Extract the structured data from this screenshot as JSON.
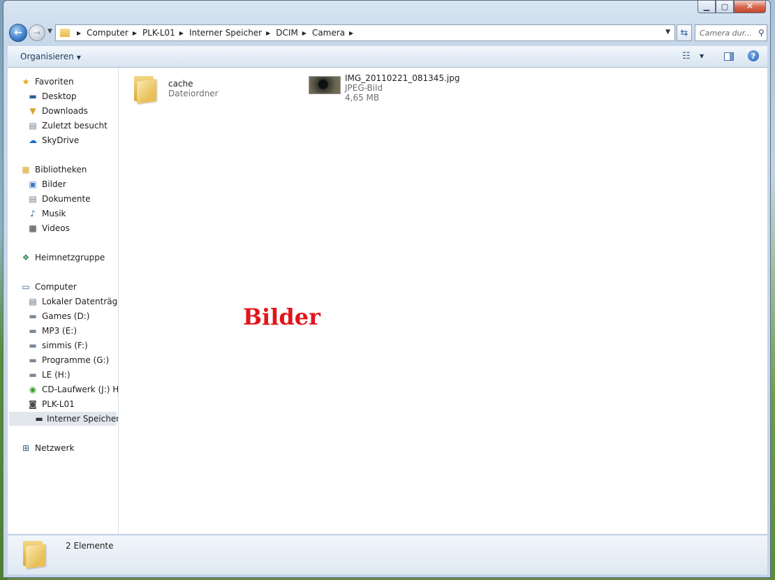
{
  "window": {
    "caption": {
      "minimize": "▁",
      "maximize": "▢",
      "close": "✕"
    }
  },
  "address": {
    "crumbs": [
      "Computer",
      "PLK-L01",
      "Interner Speicher",
      "DCIM",
      "Camera"
    ],
    "search_placeholder": "Camera dur..."
  },
  "toolbar": {
    "organize_label": "Organisieren"
  },
  "sidebar": {
    "favorites": {
      "header": "Favoriten",
      "items": [
        "Desktop",
        "Downloads",
        "Zuletzt besucht",
        "SkyDrive"
      ]
    },
    "libraries": {
      "header": "Bibliotheken",
      "items": [
        "Bilder",
        "Dokumente",
        "Musik",
        "Videos"
      ]
    },
    "homegroup": "Heimnetzgruppe",
    "computer": {
      "header": "Computer",
      "items": [
        "Lokaler Datenträger",
        "Games (D:)",
        "MP3 (E:)",
        "simmis (F:)",
        "Programme (G:)",
        "LE (H:)",
        "CD-Laufwerk (J:) HiS",
        "PLK-L01",
        "Interner Speicher"
      ]
    },
    "network": "Netzwerk"
  },
  "files": [
    {
      "name": "cache",
      "type": "Dateiordner",
      "size": ""
    },
    {
      "name": "IMG_20110221_081345.jpg",
      "type": "JPEG-Bild",
      "size": "4,65 MB"
    }
  ],
  "overlay_text": "Bilder",
  "status": {
    "count": "2 Elemente"
  },
  "colors": {
    "overlay": "#e0161b",
    "selection": "#e2e7ee"
  }
}
